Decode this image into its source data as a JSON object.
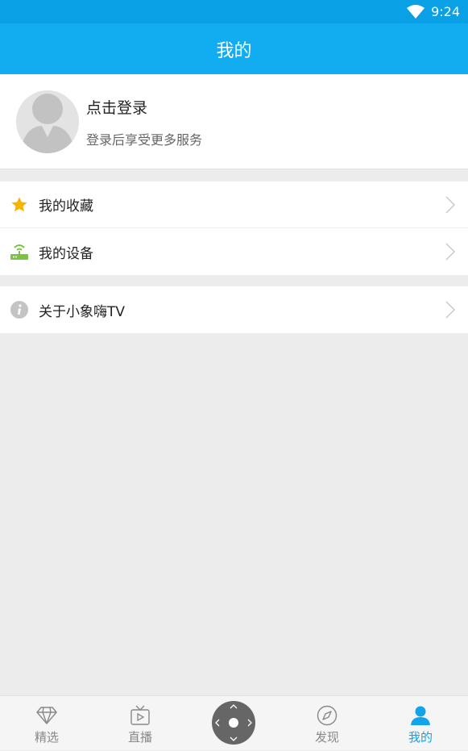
{
  "status": {
    "time": "9:24",
    "wifi_icon": "wifi-icon"
  },
  "header": {
    "title": "我的"
  },
  "profile": {
    "avatar_icon": "default-avatar-icon",
    "login_label": "点击登录",
    "subtitle": "登录后享受更多服务"
  },
  "menu_group1": [
    {
      "label": "我的收藏",
      "icon": "star-icon",
      "icon_color": "#f7b500"
    },
    {
      "label": "我的设备",
      "icon": "router-icon",
      "icon_color": "#7cc242"
    }
  ],
  "menu_group2": [
    {
      "label": "关于小象嗨TV",
      "icon": "info-icon",
      "icon_color": "#c4c4c4"
    }
  ],
  "tabbar": {
    "tabs": [
      {
        "label": "精选",
        "icon": "diamond-icon"
      },
      {
        "label": "直播",
        "icon": "tv-icon"
      },
      {
        "label": "",
        "icon": "remote-control-icon"
      },
      {
        "label": "发现",
        "icon": "compass-icon"
      },
      {
        "label": "我的",
        "icon": "person-icon",
        "active": true
      }
    ]
  },
  "colors": {
    "primary": "#12adf0",
    "active_tab": "#12a3e8",
    "background": "#ececec"
  }
}
